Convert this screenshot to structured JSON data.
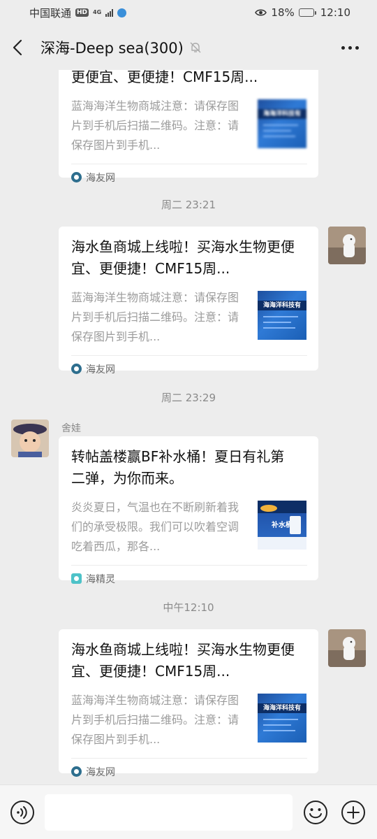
{
  "status_bar": {
    "carrier": "中国联通",
    "hd": "HD",
    "network": "4G",
    "battery": "18%",
    "battery_level": 0.18,
    "time": "12:10"
  },
  "header": {
    "title": "深海-Deep sea(300)"
  },
  "messages": [
    {
      "type": "card",
      "title": "更便宜、更便捷！CMF15周...",
      "desc": "蓝海海洋生物商城注意：请保存图片到手机后扫描二维码。注意：请保存图片到手机...",
      "source": "海友网"
    },
    {
      "type": "time",
      "text": "周二 23:21"
    },
    {
      "type": "card",
      "title": "海水鱼商城上线啦！买海水生物更便宜、更便捷！CMF15周...",
      "desc": "蓝海海洋生物商城注意：请保存图片到手机后扫描二维码。注意：请保存图片到手机...",
      "source": "海友网"
    },
    {
      "type": "time",
      "text": "周二 23:29"
    },
    {
      "type": "card",
      "sender": "舍娃",
      "title": "转帖盖楼赢BF补水桶！夏日有礼第二弹，为你而来。",
      "desc": "炎炎夏日，气温也在不断刷新着我们的承受极限。我们可以吹着空调吃着西瓜，那各...",
      "source": "海精灵",
      "thumb_text": "补水桶"
    },
    {
      "type": "time",
      "text": "中午12:10"
    },
    {
      "type": "card",
      "title": "海水鱼商城上线啦！买海水生物更便宜、更便捷！CMF15周...",
      "desc": "蓝海海洋生物商城注意：请保存图片到手机后扫描二维码。注意：请保存图片到手机...",
      "source": "海友网"
    }
  ],
  "thumb_text_a": "海海洋科技有",
  "colors": {
    "background": "#ededed",
    "card": "#ffffff",
    "input_bar": "#f6f6f6"
  }
}
